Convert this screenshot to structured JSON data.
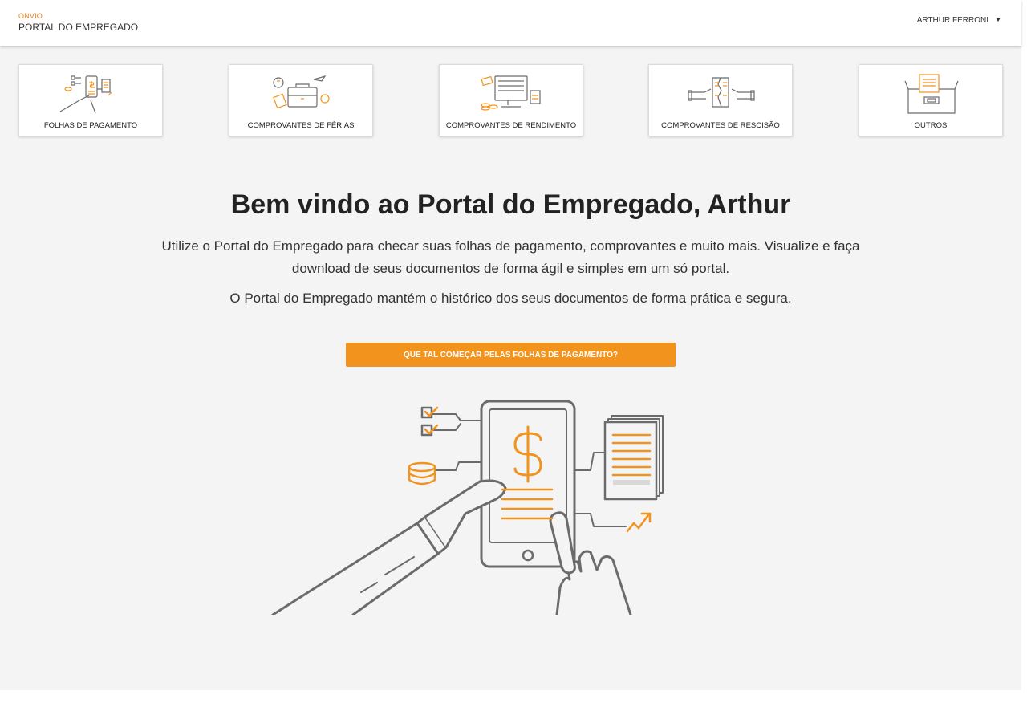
{
  "header": {
    "brand_small": "ONVIO",
    "brand_title": "PORTAL DO EMPREGADO",
    "user_name": "ARTHUR FERRONI"
  },
  "cards": [
    {
      "label": "FOLHAS DE PAGAMENTO",
      "icon": "payroll-icon"
    },
    {
      "label": "COMPROVANTES DE FÉRIAS",
      "icon": "vacation-icon"
    },
    {
      "label": "COMPROVANTES DE RENDIMENTO",
      "icon": "income-icon"
    },
    {
      "label": "COMPROVANTES DE RESCISÃO",
      "icon": "termination-icon"
    },
    {
      "label": "OUTROS",
      "icon": "others-icon"
    }
  ],
  "main": {
    "welcome": "Bem vindo ao Portal do Empregado, Arthur",
    "intro": "Utilize o Portal do Empregado para checar suas folhas de pagamento, comprovantes e muito mais. Visualize e faça download de seus documentos de forma ágil e simples em um só portal.",
    "history": "O Portal do Empregado mantém o histórico dos seus documentos de forma prática e segura.",
    "cta_label": "QUE TAL COMEÇAR PELAS FOLHAS DE PAGAMENTO?"
  },
  "colors": {
    "accent": "#f2931d",
    "brand": "#e87d1e",
    "background": "#f4f4f5",
    "line_art": "#6b6b6b"
  }
}
